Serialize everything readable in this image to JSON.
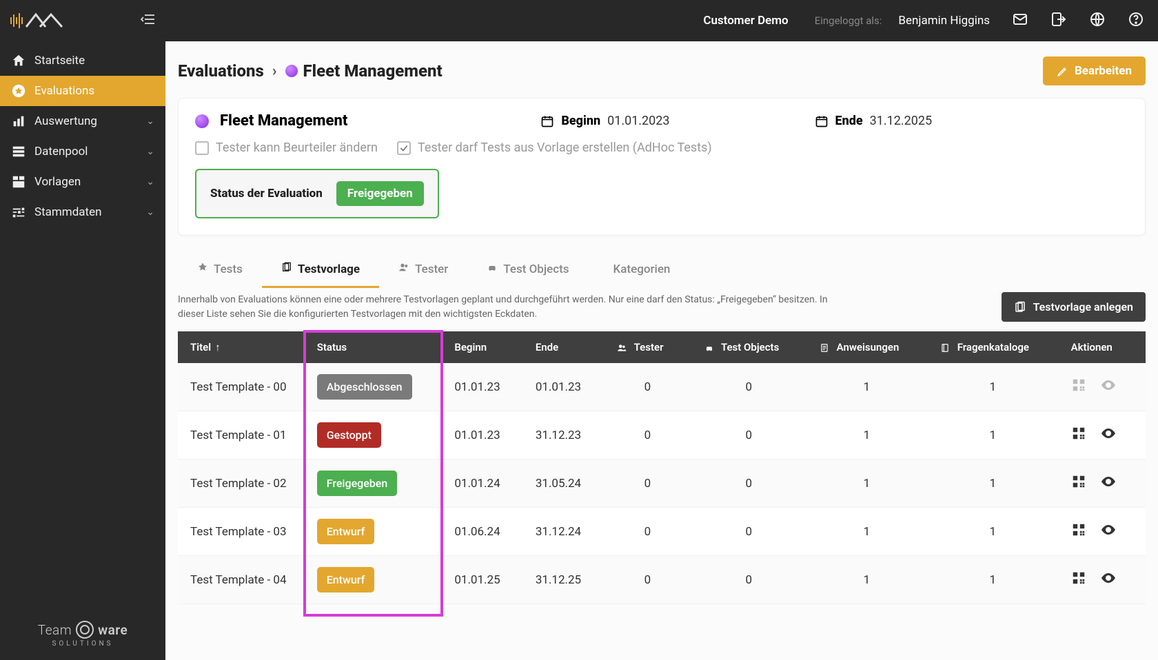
{
  "sidebar": {
    "items": [
      {
        "label": "Startseite",
        "icon": "home"
      },
      {
        "label": "Evaluations",
        "icon": "star",
        "active": true
      },
      {
        "label": "Auswertung",
        "icon": "bar-chart",
        "expandable": true
      },
      {
        "label": "Datenpool",
        "icon": "storage",
        "expandable": true
      },
      {
        "label": "Vorlagen",
        "icon": "dashboard",
        "expandable": true
      },
      {
        "label": "Stammdaten",
        "icon": "tune",
        "expandable": true
      }
    ],
    "footer_brand": "Team     ware",
    "footer_sub": "SOLUTIONS"
  },
  "topbar": {
    "customer": "Customer Demo",
    "logged_in_label": "Eingeloggt als:",
    "user": "Benjamin Higgins"
  },
  "breadcrumb": {
    "root": "Evaluations",
    "leaf": "Fleet Management",
    "edit_label": "Bearbeiten"
  },
  "card": {
    "title": "Fleet Management",
    "begin_label": "Beginn",
    "begin_value": "01.01.2023",
    "end_label": "Ende",
    "end_value": "31.12.2025",
    "checkbox1_label": "Tester kann Beurteiler ändern",
    "checkbox1_checked": false,
    "checkbox2_label": "Tester darf Tests aus Vorlage erstellen (AdHoc Tests)",
    "checkbox2_checked": true,
    "status_label": "Status der Evaluation",
    "status_value": "Freigegeben"
  },
  "tabs": {
    "items": [
      {
        "label": "Tests"
      },
      {
        "label": "Testvorlage",
        "active": true
      },
      {
        "label": "Tester"
      },
      {
        "label": "Test Objects"
      },
      {
        "label": "Kategorien"
      }
    ]
  },
  "subtext": "Innerhalb von Evaluations können eine oder mehrere Testvorlagen geplant und durchgeführt werden. Nur eine darf den Status: „Freigegeben“ besitzen. In dieser Liste sehen Sie die konfigurierten Testvorlagen mit den wichtigsten Eckdaten.",
  "create_button": "Testvorlage anlegen",
  "table": {
    "columns": {
      "title": "Titel",
      "status": "Status",
      "begin": "Beginn",
      "end": "Ende",
      "tester": "Tester",
      "objects": "Test Objects",
      "instructions": "Anweisungen",
      "catalogs": "Fragenkataloge",
      "actions": "Aktionen"
    },
    "rows": [
      {
        "title": "Test Template - 00",
        "status": "Abgeschlossen",
        "status_class": "grey",
        "begin": "01.01.23",
        "end": "01.01.23",
        "tester": "0",
        "objects": "0",
        "instructions": "1",
        "catalogs": "1",
        "muted": true
      },
      {
        "title": "Test Template - 01",
        "status": "Gestoppt",
        "status_class": "red",
        "begin": "01.01.23",
        "end": "31.12.23",
        "tester": "0",
        "objects": "0",
        "instructions": "1",
        "catalogs": "1"
      },
      {
        "title": "Test Template - 02",
        "status": "Freigegeben",
        "status_class": "green",
        "begin": "01.01.24",
        "end": "31.05.24",
        "tester": "0",
        "objects": "0",
        "instructions": "1",
        "catalogs": "1"
      },
      {
        "title": "Test Template - 03",
        "status": "Entwurf",
        "status_class": "amber",
        "begin": "01.06.24",
        "end": "31.12.24",
        "tester": "0",
        "objects": "0",
        "instructions": "1",
        "catalogs": "1"
      },
      {
        "title": "Test Template - 04",
        "status": "Entwurf",
        "status_class": "amber",
        "begin": "01.01.25",
        "end": "31.12.25",
        "tester": "0",
        "objects": "0",
        "instructions": "1",
        "catalogs": "1"
      }
    ]
  }
}
